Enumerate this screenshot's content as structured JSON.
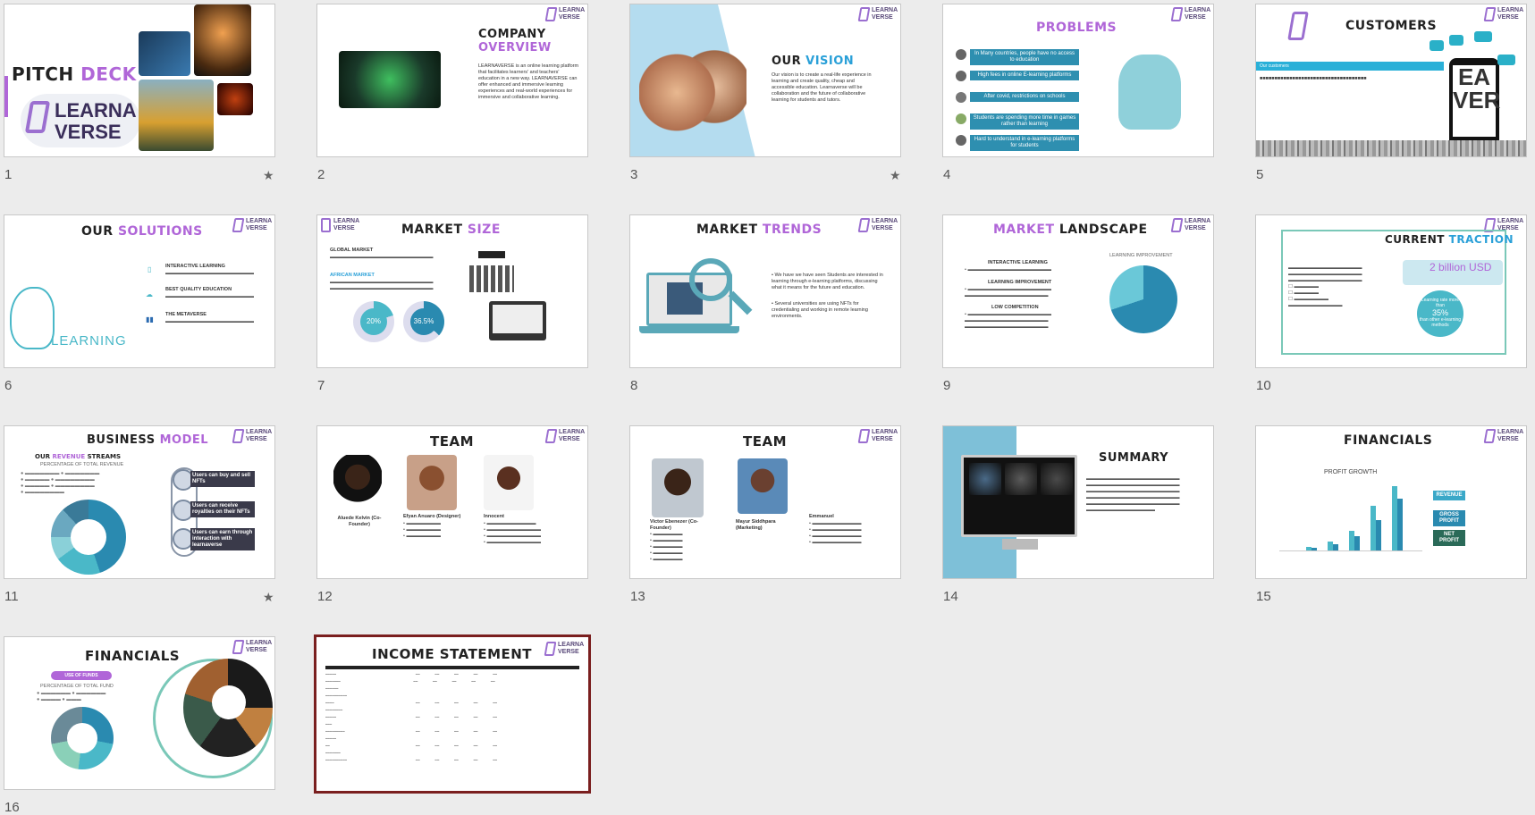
{
  "slides": [
    {
      "num": "1",
      "title_a": "PITCH ",
      "title_b": "DECK",
      "logo1": "LEARNA",
      "logo2": "VERSE",
      "starred": true
    },
    {
      "num": "2",
      "title_a": "COMPANY",
      "title_b": "OVERVIEW",
      "body": "LEARNAVERSE is an online learning platform that facilitates learners' and teachers' education in a new way. LEARNAVERSE can offer enhanced and immersive learning experiences and real-world experiences for immersive and collaborative learning."
    },
    {
      "num": "3",
      "title_a": "OUR ",
      "title_b": "VISION",
      "body": "Our vision is to create a real-life experience in learning and create quality, cheap and accessible education. Learnaverse will be collaboration and the future of collaborative learning for students and tutors.",
      "starred": true
    },
    {
      "num": "4",
      "title_a": "PROBLEMS",
      "items": [
        "In Many countries, people have no access to education",
        "High fees in online E-learning platforms",
        "After covid, restrictions on schools",
        "Students are spending more time in games rather than learning",
        "Hard to understand in e-learning platforms for students"
      ]
    },
    {
      "num": "5",
      "title_a": "CUSTOMERS",
      "tag": "Our customers"
    },
    {
      "num": "6",
      "title_a": "OUR ",
      "title_b": "SOLUTIONS",
      "items": [
        "INTERACTIVE LEARNING",
        "BEST QUALITY EDUCATION",
        "THE METAVERSE"
      ],
      "learning": "LEARNING"
    },
    {
      "num": "7",
      "title_a": "MARKET ",
      "title_b": "SIZE",
      "h1": "GLOBAL MARKET",
      "h2": "AFRICAN MARKET",
      "p1": "20%",
      "p2": "36.5%"
    },
    {
      "num": "8",
      "title_a": "MARKET ",
      "title_b": "TRENDS",
      "b1": "We have we have seen Students are interested in learning through e-learning platforms, discussing what it means for the future and education.",
      "b2": "Several universities are using NFTs for credentialing and working in remote learning environments."
    },
    {
      "num": "9",
      "title_a": "MARKET ",
      "title_b": "LANDSCAPE",
      "h1": "INTERACTIVE LEARNING",
      "h2": "LEARNING IMPROVEMENT",
      "h3": "LOW COMPETITION",
      "chart": "LEARNING IMPROVEMENT"
    },
    {
      "num": "10",
      "title_a": "CURRENT ",
      "title_b": "TRACTION",
      "big": "2 billion USD",
      "circle1": "Learning rate more than",
      "circle2": "35%",
      "circle3": "than other e-learning methods"
    },
    {
      "num": "11",
      "title_a": "BUSINESS ",
      "title_b": "MODEL",
      "sub_a": "OUR ",
      "sub_b": "REVENUE ",
      "sub_c": "STREAMS",
      "chart": "PERCENTAGE OF TOTAL REVENUE",
      "items": [
        "Users can buy and sell NFTs",
        "Users can receive royalties on their NFTs",
        "Users can earn through interaction with learnaverse"
      ],
      "starred": true
    },
    {
      "num": "12",
      "title_a": "TEAM",
      "names": [
        "Aluede Kelvin (Co-Founder)",
        "Efyan Anuaro (Designer)",
        "Innocent"
      ]
    },
    {
      "num": "13",
      "title_a": "TEAM",
      "names": [
        "Victor Ebenezer (Co-Founder)",
        "Mayur Siddhpara (Marketing)",
        "Emmanuel"
      ]
    },
    {
      "num": "14",
      "title_a": "SUMMARY"
    },
    {
      "num": "15",
      "title_a": "FINANCIALS",
      "chart": "PROFIT GROWTH",
      "legend": [
        "REVENUE",
        "GROSS PROFIT",
        "NET PROFIT"
      ]
    },
    {
      "num": "16",
      "title_a": "FINANCIALS",
      "badge": "USE OF FUNDS",
      "chart": "PERCENTAGE OF TOTAL FUND"
    },
    {
      "num": "17",
      "title_a": "INCOME STATEMENT"
    }
  ]
}
